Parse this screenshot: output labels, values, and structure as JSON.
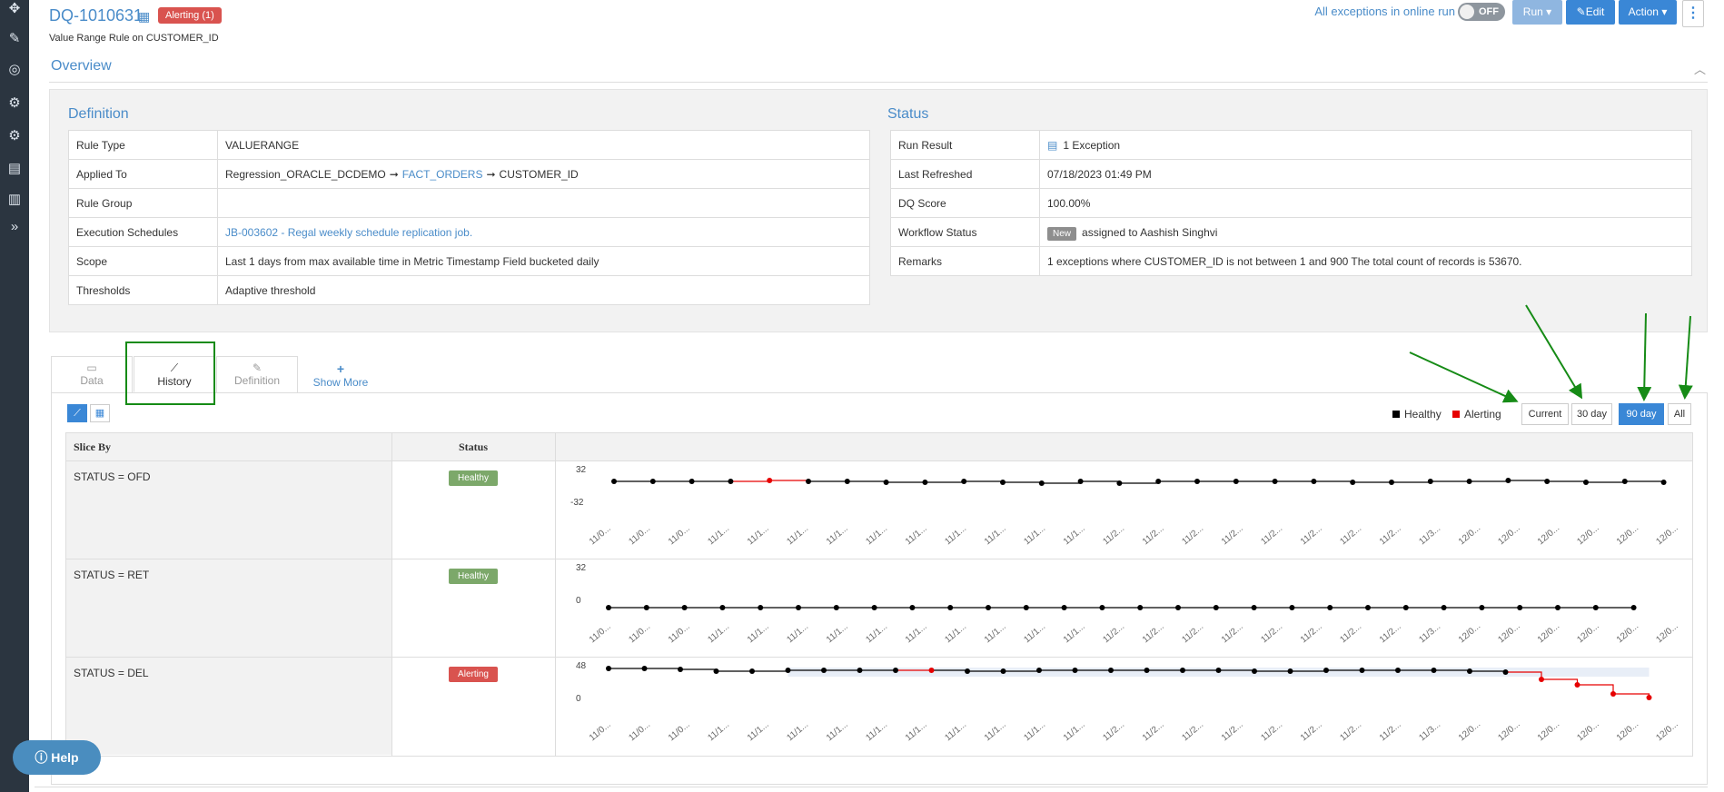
{
  "header": {
    "title": "DQ-1010631",
    "alert_badge": "Alerting (1)",
    "subtitle": "Value Range Rule on CUSTOMER_ID",
    "online_text": "All exceptions in online run",
    "toggle_label": "OFF",
    "run_label": "Run",
    "edit_label": "Edit",
    "action_label": "Action",
    "more_label": "⋮"
  },
  "overview": {
    "title": "Overview"
  },
  "definition": {
    "title": "Definition",
    "rule_type_label": "Rule Type",
    "rule_type": "VALUERANGE",
    "applied_to_label": "Applied To",
    "applied_source": "Regression_ORACLE_DCDEMO",
    "applied_table": "FACT_ORDERS",
    "applied_column": "CUSTOMER_ID",
    "rule_group_label": "Rule Group",
    "rule_group": "",
    "exec_label": "Execution Schedules",
    "exec_value": "JB-003602  -  Regal weekly schedule replication job.",
    "scope_label": "Scope",
    "scope_value": "Last 1 days from max available time in Metric Timestamp Field bucketed daily",
    "thresholds_label": "Thresholds",
    "thresholds_value": "Adaptive threshold"
  },
  "status": {
    "title": "Status",
    "run_result_label": "Run Result",
    "run_result": "1 Exception",
    "last_refreshed_label": "Last Refreshed",
    "last_refreshed": "07/18/2023 01:49 PM",
    "dq_score_label": "DQ Score",
    "dq_score": "100.00%",
    "workflow_label": "Workflow Status",
    "workflow_badge": "New",
    "workflow_text": "assigned to Aashish Singhvi",
    "remarks_label": "Remarks",
    "remarks": "1 exceptions where CUSTOMER_ID is not between 1 and 900 The total count of records is 53670."
  },
  "tabs": {
    "data": "Data",
    "history": "History",
    "definition": "Definition",
    "show_more": "Show More"
  },
  "legend": {
    "healthy": "Healthy",
    "alerting": "Alerting",
    "healthy_color": "#000000",
    "alerting_color": "#e60000"
  },
  "ranges": [
    "Current",
    "30 day",
    "90 day",
    "All"
  ],
  "slice_table": {
    "col_slice": "Slice By",
    "col_status": "Status",
    "rows": [
      {
        "slice": "STATUS = OFD",
        "status": "Healthy",
        "ymax": "32",
        "ymin": "-32"
      },
      {
        "slice": "STATUS = RET",
        "status": "Healthy",
        "ymax": "32",
        "ymin": "0"
      },
      {
        "slice": "STATUS = DEL",
        "status": "Alerting",
        "ymax": "48",
        "ymin": "0"
      }
    ],
    "x_ticks": [
      "11/0...",
      "11/0...",
      "11/0...",
      "11/1...",
      "11/1...",
      "11/1...",
      "11/1...",
      "11/1...",
      "11/1...",
      "11/1...",
      "11/1...",
      "11/1...",
      "11/1...",
      "11/2...",
      "11/2...",
      "11/2...",
      "11/2...",
      "11/2...",
      "11/2...",
      "11/2...",
      "11/2...",
      "11/3...",
      "12/0...",
      "12/0...",
      "12/0...",
      "12/0...",
      "12/0...",
      "12/0..."
    ]
  },
  "help": {
    "label": "Help"
  }
}
